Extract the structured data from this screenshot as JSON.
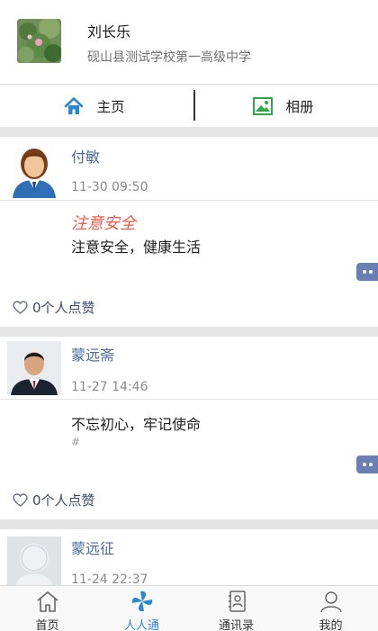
{
  "profile": {
    "name": "刘长乐",
    "school": "砚山县测试学校第一高级中学"
  },
  "tabs": [
    {
      "label": "主页",
      "icon": "home-icon"
    },
    {
      "label": "相册",
      "icon": "album-icon"
    }
  ],
  "posts": [
    {
      "author": "付敏",
      "time": "11-30 09:50",
      "title": "注意安全",
      "content": "注意安全，健康生活",
      "hash": "",
      "likes": "0个人点赞"
    },
    {
      "author": "蒙远斋",
      "time": "11-27 14:46",
      "title": "",
      "content": "不忘初心，牢记使命",
      "hash": "#",
      "likes": "0个人点赞"
    },
    {
      "author": "蒙远征",
      "time": "11-24 22:37"
    }
  ],
  "bottom_nav": [
    {
      "label": "首页",
      "icon": "home-outline-icon"
    },
    {
      "label": "人人通",
      "icon": "pinwheel-icon",
      "active": true
    },
    {
      "label": "通讯录",
      "icon": "contacts-book-icon"
    },
    {
      "label": "我的",
      "icon": "user-icon"
    }
  ],
  "colors": {
    "accent_blue": "#2c86d6",
    "title_red": "#f25b4a",
    "author_blue": "#4a6aa0",
    "album_green": "#2aa84a",
    "gap_gray": "#e5e5e5"
  }
}
